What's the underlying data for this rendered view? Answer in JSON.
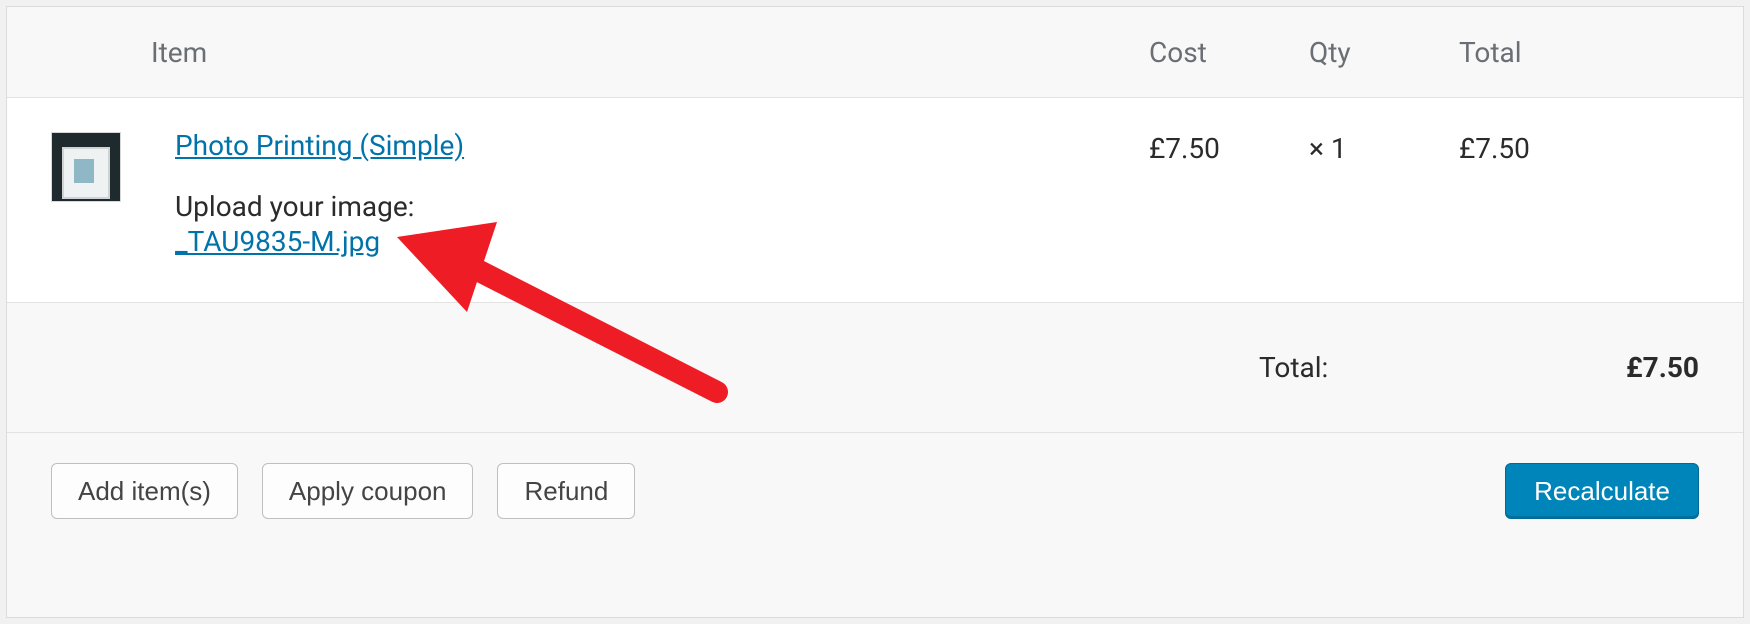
{
  "table": {
    "headers": {
      "item": "Item",
      "cost": "Cost",
      "qty": "Qty",
      "total": "Total"
    },
    "row": {
      "product_name": "Photo Printing (Simple)",
      "meta_label": "Upload your image:",
      "file_name": "_TAU9835-M.jpg",
      "cost": "£7.50",
      "qty": "× 1",
      "total": "£7.50"
    }
  },
  "totals": {
    "label": "Total:",
    "value": "£7.50"
  },
  "actions": {
    "add_item": "Add item(s)",
    "apply_coupon": "Apply coupon",
    "refund": "Refund",
    "recalculate": "Recalculate"
  }
}
